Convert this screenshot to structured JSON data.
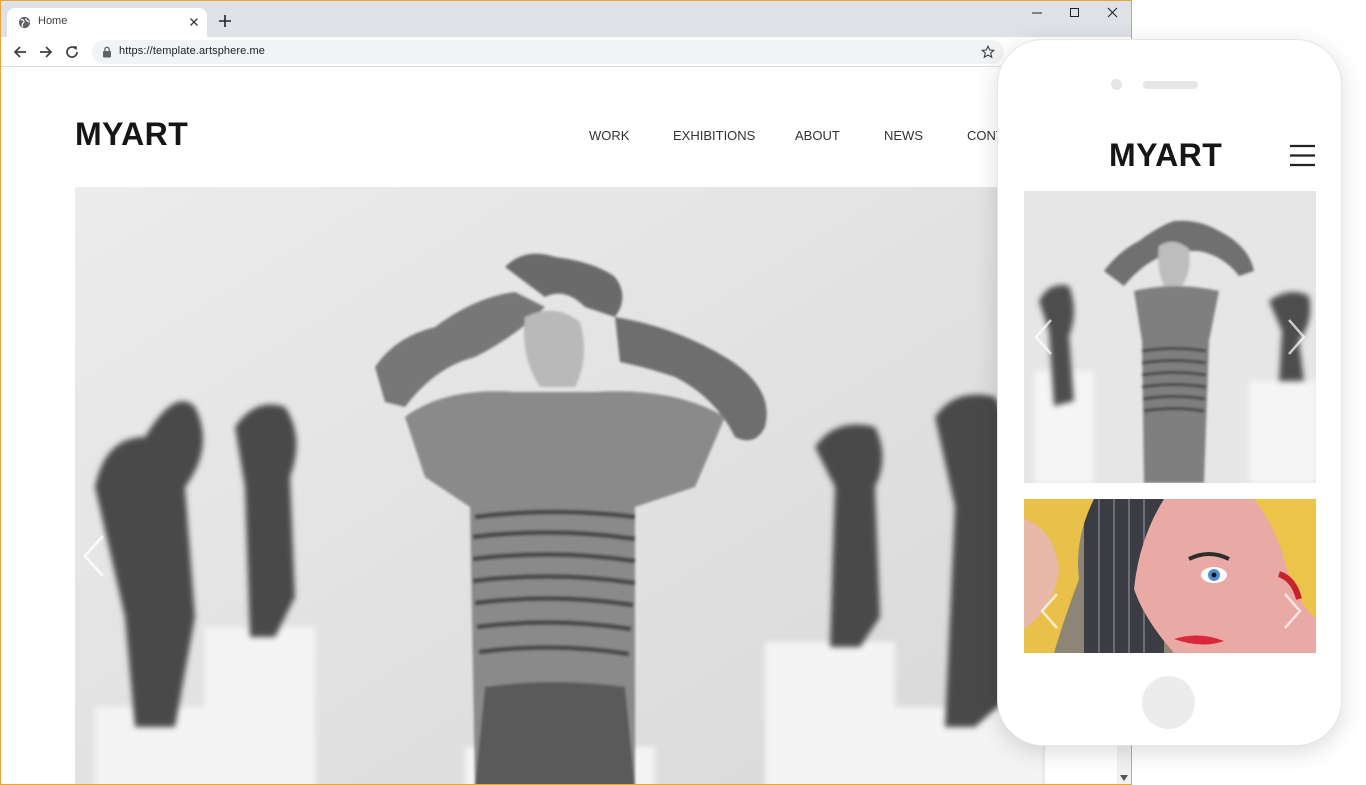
{
  "browser": {
    "tab_title": "Home",
    "url": "https://template.artsphere.me"
  },
  "site": {
    "logo": "MYART",
    "nav": [
      "WORK",
      "EXHIBITIONS",
      "ABOUT",
      "NEWS",
      "CONT"
    ]
  },
  "mobile": {
    "logo": "MYART"
  },
  "colors": {
    "window_border": "#e8a33d",
    "tabstrip": "#dee1e6",
    "logo_text": "#161616"
  },
  "icons": {
    "tab_favicon": "globe-icon",
    "hero_prev": "chevron-left-icon",
    "mobile_menu": "hamburger-icon"
  }
}
